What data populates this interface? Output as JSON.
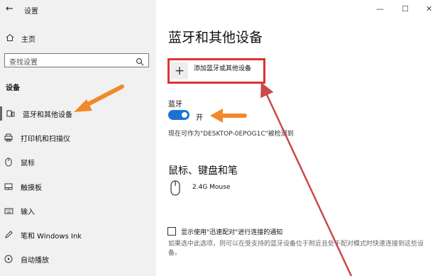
{
  "window": {
    "back": "←",
    "title": "设置",
    "minimize": "—",
    "maximize": "☐",
    "close": "✕"
  },
  "sidebar": {
    "home": "主页",
    "search_placeholder": "查找设置",
    "section": "设备",
    "items": [
      {
        "label": "蓝牙和其他设备",
        "icon": "bluetooth-devices-icon",
        "active": true
      },
      {
        "label": "打印机和扫描仪",
        "icon": "printer-icon"
      },
      {
        "label": "鼠标",
        "icon": "mouse-icon"
      },
      {
        "label": "触摸板",
        "icon": "touchpad-icon"
      },
      {
        "label": "输入",
        "icon": "keyboard-icon"
      },
      {
        "label": "笔和 Windows Ink",
        "icon": "pen-icon"
      },
      {
        "label": "自动播放",
        "icon": "autoplay-icon"
      }
    ]
  },
  "main": {
    "title": "蓝牙和其他设备",
    "add_button": {
      "icon": "+",
      "label": "添加蓝牙或其他设备"
    },
    "bluetooth": {
      "label": "蓝牙",
      "state": "开",
      "on": true,
      "discoverable": "现在可作为\"DESKTOP-0EPOG1C\"被检测到"
    },
    "section2": "鼠标、键盘和笔",
    "device": {
      "name": "2.4G Mouse",
      "icon": "mouse-icon"
    },
    "swift_pair": {
      "label": "显示使用\"迅速配对\"进行连接的通知",
      "checked": false,
      "description": "如果选中此选项，则可以在受支持的蓝牙设备位于附近且处于配对模式时快速连接到这些设备。"
    }
  },
  "annotations": {
    "highlight_color": "#d33333",
    "arrow_color": "#f0892a",
    "arrow_line_color": "#c94a4a"
  }
}
